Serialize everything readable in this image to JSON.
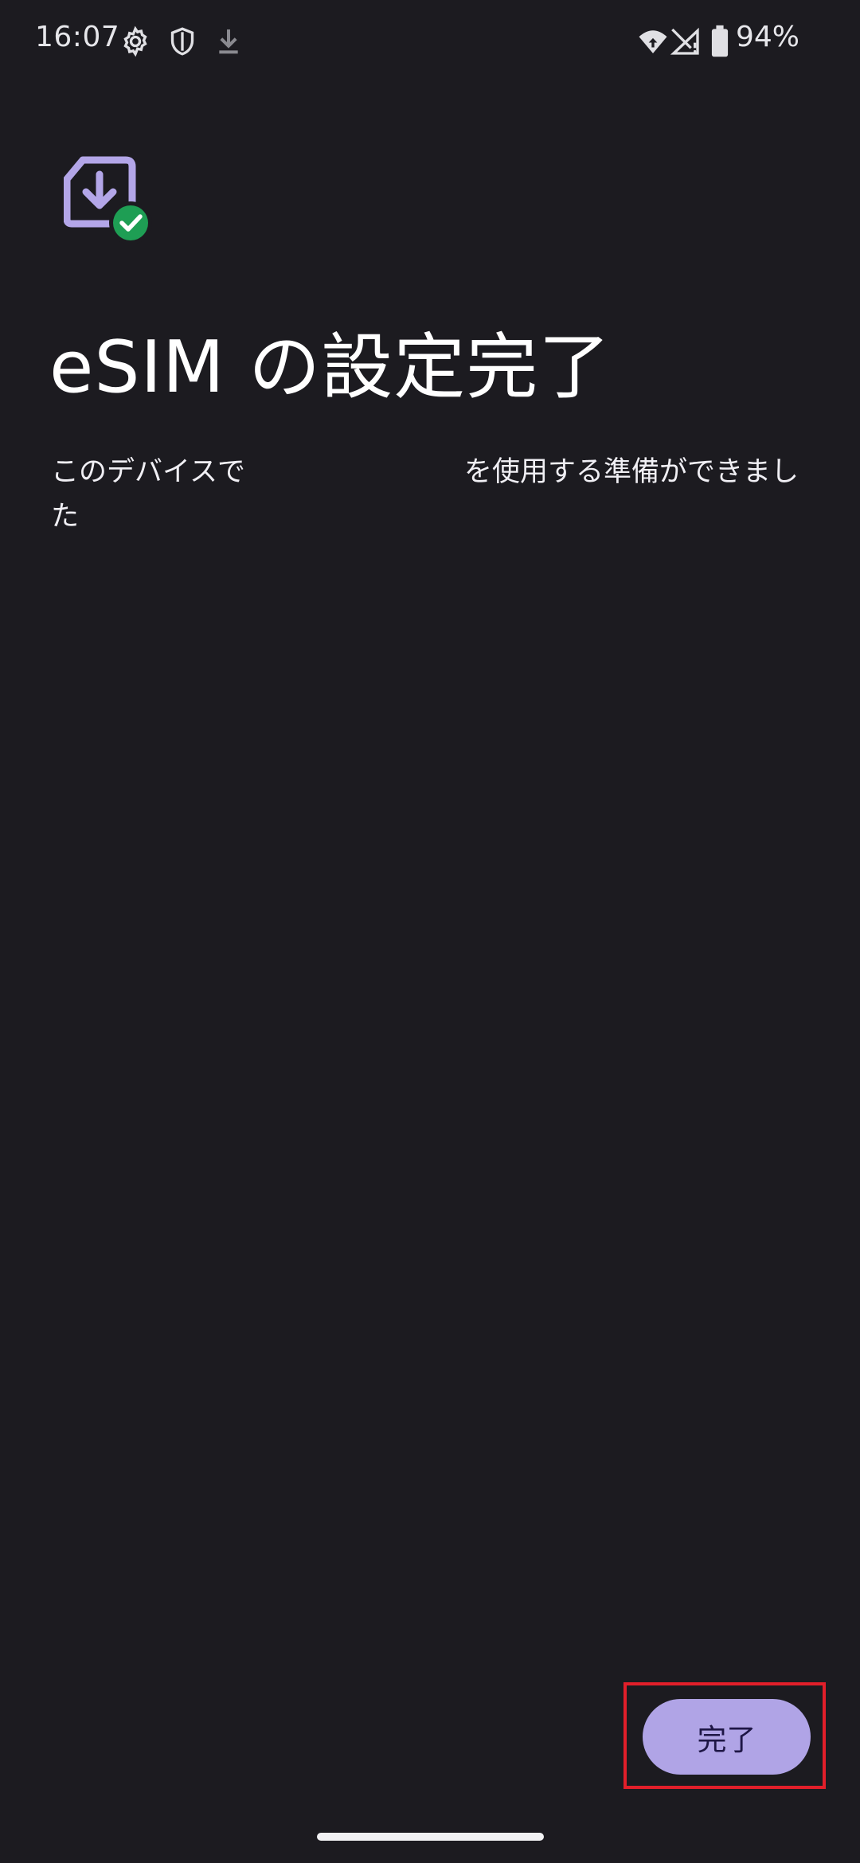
{
  "status_bar": {
    "time": "16:07",
    "battery_percent": "94%",
    "icons": [
      "settings-icon",
      "shield-icon",
      "download-icon",
      "wifi-icon",
      "no-signal-icon",
      "battery-icon"
    ]
  },
  "header": {
    "icon": "esim-download-check-icon",
    "title": "eSIM の設定完了"
  },
  "main": {
    "message_part1": "このデバイスで",
    "message_part2": "を使用する準備ができまし",
    "message_part3": "た"
  },
  "footer": {
    "done_label": "完了"
  },
  "colors": {
    "background": "#1c1b20",
    "accent": "#b0a4e6",
    "check_green": "#1e9e54",
    "highlight_red": "#e21f2a"
  }
}
